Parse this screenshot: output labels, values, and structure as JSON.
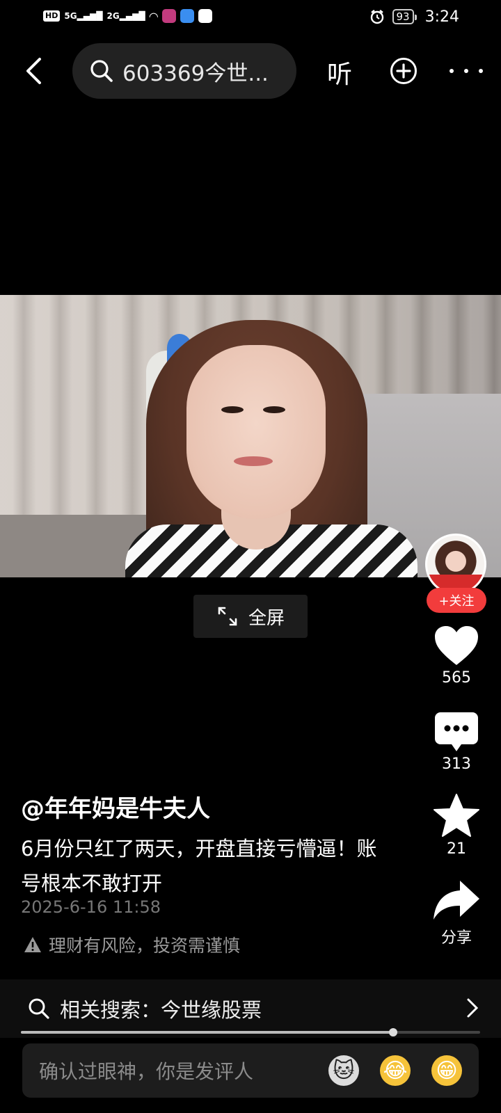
{
  "status_bar": {
    "left_badges": [
      "HD",
      "5G",
      "2G"
    ],
    "battery": "93",
    "time": "3:24"
  },
  "top_bar": {
    "search_text": "603369今世...",
    "listen_label": "听"
  },
  "video": {
    "fullscreen_label": "全屏",
    "progress_fraction": 0.81
  },
  "author": {
    "follow_label": "+关注",
    "username": "@年年妈是牛夫人"
  },
  "actions": {
    "likes": "565",
    "comments": "313",
    "favorites": "21",
    "share_label": "分享"
  },
  "post": {
    "caption": "6月份只红了两天，开盘直接亏懵逼！账号根本不敢打开",
    "date": "2025-6-16 11:58",
    "risk_notice": "理财有风险，投资需谨慎"
  },
  "related_search": {
    "label": "相关搜索：今世缘股票"
  },
  "comment_bar": {
    "placeholder": "确认过眼神，你是发评人",
    "emojis": [
      "cat-face",
      "laughing-tears",
      "grinning"
    ]
  },
  "colors": {
    "background": "#000000",
    "follow_red": "#f23c3c",
    "icon_white": "#ffffff"
  }
}
